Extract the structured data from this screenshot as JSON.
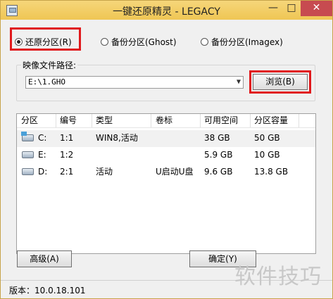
{
  "window": {
    "title": "一键还原精灵 - LEGACY",
    "minimize": "—",
    "maximize": "□",
    "close": "✕"
  },
  "mode_options": [
    {
      "label": "还原分区(R)",
      "checked": true
    },
    {
      "label": "备份分区(Ghost)",
      "checked": false
    },
    {
      "label": "备份分区(Imagex)",
      "checked": false
    }
  ],
  "image_path": {
    "group_label": "映像文件路径:",
    "value": "E:\\1.GHO",
    "browse_label": "浏览(B)"
  },
  "partition_table": {
    "headers": [
      "分区",
      "编号",
      "类型",
      "卷标",
      "可用空间",
      "分区容量"
    ],
    "rows": [
      {
        "drive": "C:",
        "number": "1:1",
        "type": "WIN8,活动",
        "label": "",
        "free": "38 GB",
        "capacity": "50 GB",
        "selected": true,
        "icon": "system-drive-icon"
      },
      {
        "drive": "E:",
        "number": "1:2",
        "type": "",
        "label": "",
        "free": "5.9 GB",
        "capacity": "10 GB",
        "selected": false,
        "icon": "drive-icon"
      },
      {
        "drive": "D:",
        "number": "2:1",
        "type": "活动",
        "label": "U启动U盘",
        "free": "9.6 GB",
        "capacity": "13.8 GB",
        "selected": false,
        "icon": "drive-icon"
      }
    ]
  },
  "buttons": {
    "advanced": "高级(A)",
    "ok": "确定(Y)"
  },
  "status": {
    "version": "版本：10.0.18.101"
  },
  "watermark": "软件技巧",
  "colors": {
    "titlebar": "#f0c95d",
    "close": "#c74b50",
    "highlight": "#e0191c"
  }
}
